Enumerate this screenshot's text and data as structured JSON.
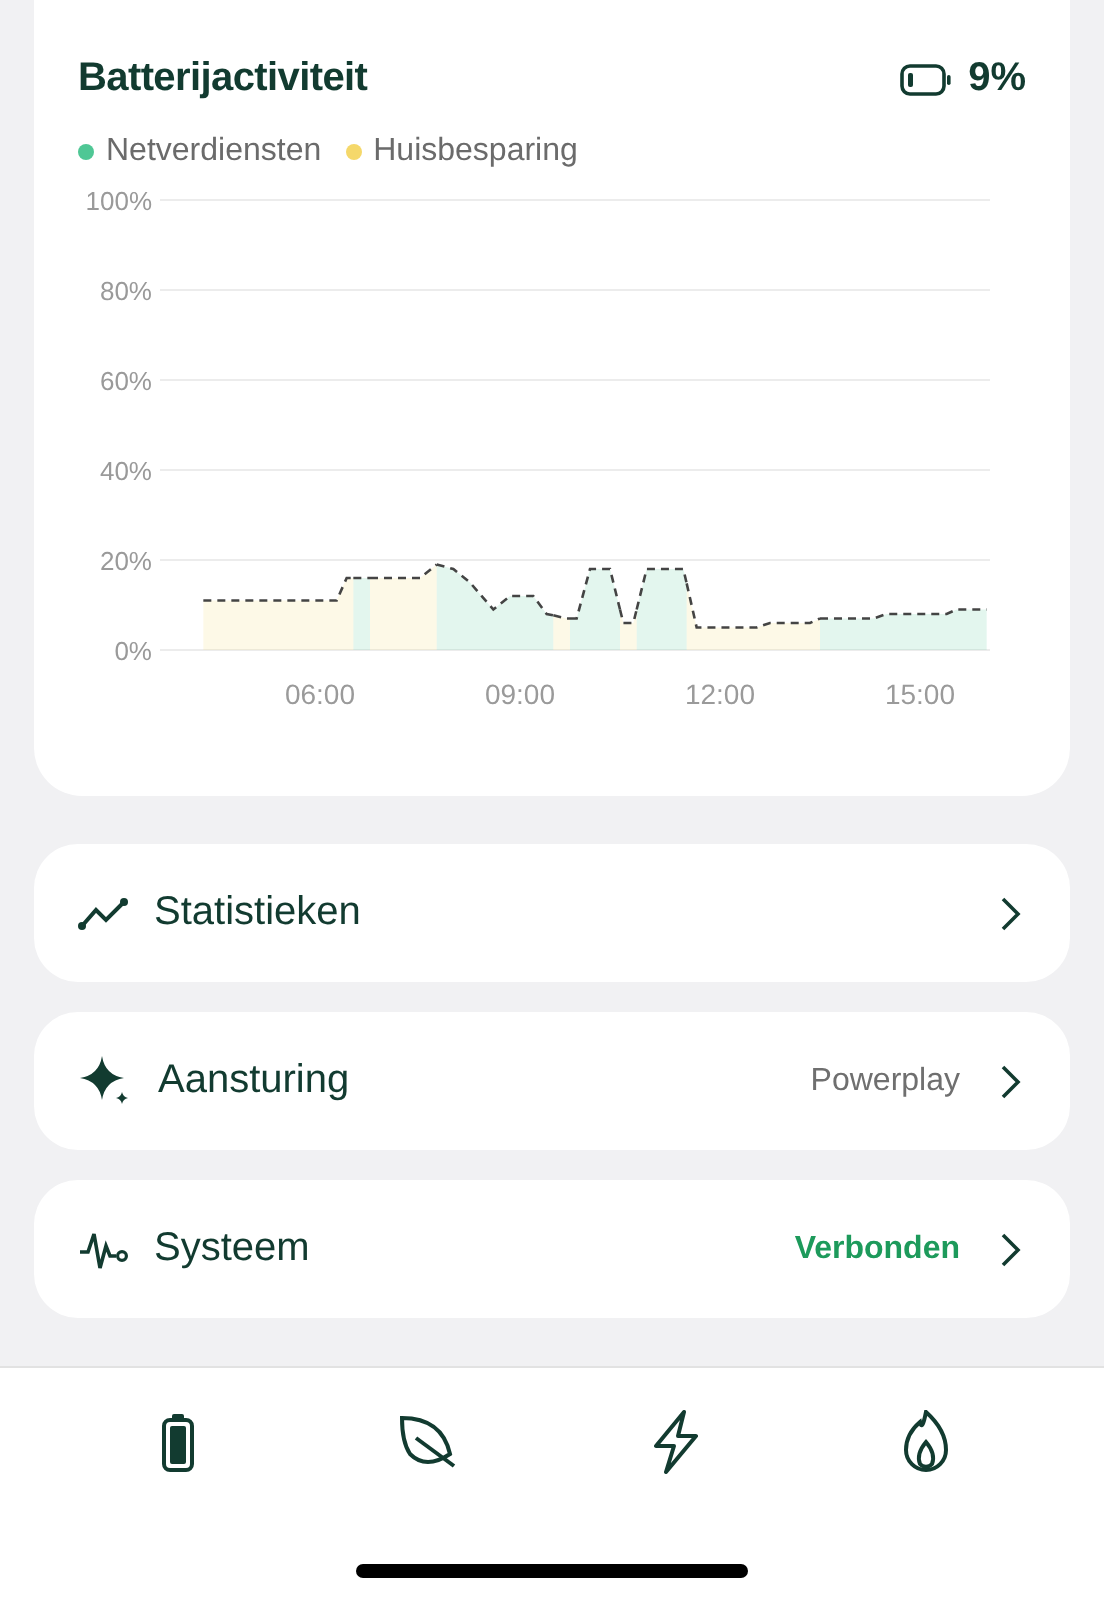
{
  "card": {
    "title": "Batterijactiviteit",
    "battery": "9%",
    "chart_data": {
      "type": "area",
      "x": [
        4.25,
        6.25,
        6.4,
        6.5,
        6.5,
        6.75,
        6.75,
        7.5,
        7.75,
        7.75,
        8.0,
        8.25,
        8.6,
        8.85,
        9.2,
        9.4,
        9.5,
        9.5,
        9.7,
        9.75,
        9.75,
        9.85,
        10.05,
        10.35,
        10.5,
        10.5,
        10.55,
        10.7,
        10.75,
        10.75,
        10.9,
        11.45,
        11.5,
        11.5,
        11.65,
        12.55,
        12.75,
        13.35,
        13.5,
        13.5,
        14.3,
        14.5,
        15.4,
        15.55,
        16.0
      ],
      "series": [
        {
          "name": "Netverdiensten",
          "color": "#4fc795",
          "line_style": "dashed",
          "values": [
            null,
            null,
            null,
            null,
            16,
            16,
            null,
            null,
            null,
            19,
            18,
            15,
            9,
            12,
            12,
            8,
            7.7,
            null,
            null,
            null,
            7,
            7,
            18,
            18,
            9,
            null,
            null,
            null,
            null,
            9,
            18,
            18,
            14.8,
            null,
            null,
            null,
            null,
            null,
            null,
            7,
            7,
            8,
            8,
            9,
            9
          ]
        },
        {
          "name": "Huisbesparing",
          "color": "#f5d86a",
          "line_style": "dashed",
          "values": [
            11,
            11,
            16,
            16,
            null,
            null,
            16,
            16,
            19,
            null,
            null,
            null,
            null,
            null,
            null,
            null,
            null,
            7.7,
            7,
            7,
            null,
            null,
            null,
            null,
            null,
            9,
            6,
            6,
            9,
            null,
            null,
            null,
            null,
            14.8,
            5,
            5,
            6,
            6,
            7,
            null,
            null,
            null,
            null,
            null,
            null
          ]
        }
      ],
      "xlim": [
        3.6,
        16.05
      ],
      "ylim": [
        0,
        100
      ],
      "grid": true,
      "xticks": [
        {
          "value": 6,
          "label": "06:00"
        },
        {
          "value": 9,
          "label": "09:00"
        },
        {
          "value": 12,
          "label": "12:00"
        },
        {
          "value": 15,
          "label": "15:00"
        }
      ],
      "yticks": [
        {
          "value": 0,
          "label": "0%"
        },
        {
          "value": 20,
          "label": "20%"
        },
        {
          "value": 40,
          "label": "40%"
        },
        {
          "value": 60,
          "label": "60%"
        },
        {
          "value": 80,
          "label": "80%"
        },
        {
          "value": 100,
          "label": "100%"
        }
      ]
    }
  },
  "menu": [
    {
      "label": "Statistieken",
      "kind": "statistics"
    },
    {
      "label": "Aansturing",
      "value": "Powerplay",
      "kind": "control"
    },
    {
      "label": "Systeem",
      "value": "Verbonden",
      "kind": "system"
    }
  ],
  "nav": [
    {
      "selected": true
    },
    {
      "selected": false
    },
    {
      "selected": false
    },
    {
      "selected": false
    }
  ]
}
